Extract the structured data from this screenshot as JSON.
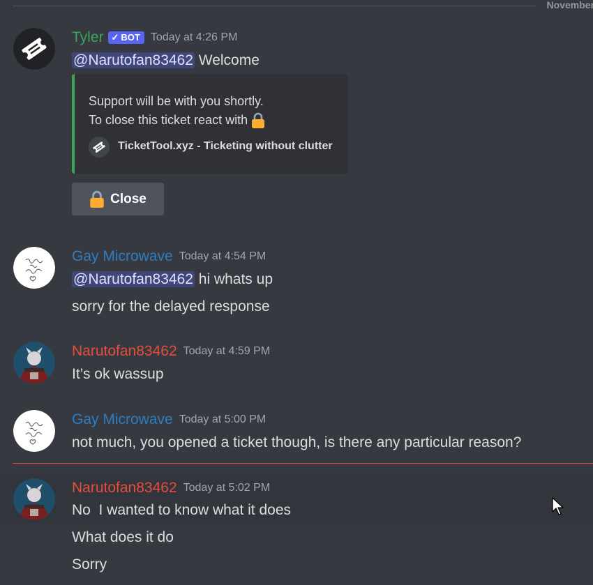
{
  "date_divider": "November",
  "colors": {
    "bot_name": "#3ba55c",
    "gay_microwave": "#2e7dc1",
    "narutofan": "#e74c3c",
    "bot_tag": "#5865f2",
    "embed_border": "#3ba55c",
    "new_divider": "#ed4245"
  },
  "messages": [
    {
      "author": "Tyler",
      "bot_tag": "BOT",
      "timestamp": "Today at 4:26 PM",
      "mention": "@Narutofan83462",
      "text": " Welcome",
      "embed": {
        "line1": "Support will be with you shortly.",
        "line2": "To close this ticket react with ",
        "line2_icon": "lock-icon",
        "footer": "TicketTool.xyz - Ticketing without clutter",
        "footer_icon": "ticket-icon"
      },
      "button_label": "Close",
      "button_icon": "lock-icon"
    },
    {
      "author": "Gay Microwave",
      "timestamp": "Today at 4:54 PM",
      "mention": "@Narutofan83462",
      "text": " hi whats up",
      "text2": "sorry for the delayed response"
    },
    {
      "author": "Narutofan83462",
      "timestamp": "Today at 4:59 PM",
      "text": "It’s ok wassup"
    },
    {
      "author": "Gay Microwave",
      "timestamp": "Today at 5:00 PM",
      "text": "not much, you opened a ticket though, is there any particular reason?"
    },
    {
      "author": "Narutofan83462",
      "timestamp": "Today at 5:02 PM",
      "text": "No  I wanted to know what it does",
      "text2": "What does it do",
      "text3": "Sorry"
    }
  ]
}
